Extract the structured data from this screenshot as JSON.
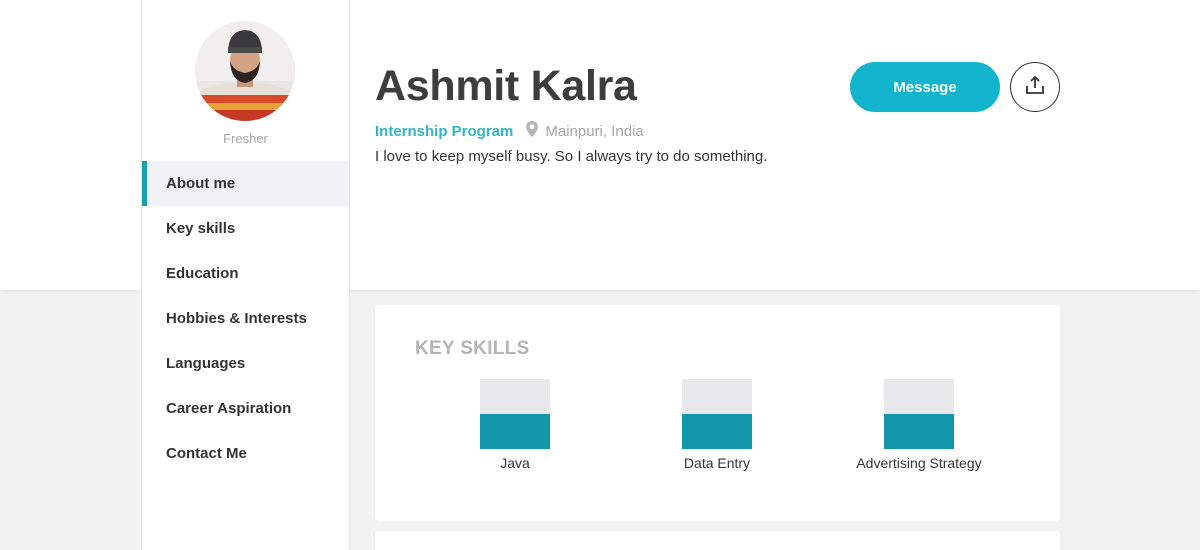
{
  "profile": {
    "role": "Fresher",
    "name": "Ashmit Kalra",
    "program": "Internship Program",
    "location": "Mainpuri, India",
    "bio": "I love to keep myself busy. So I always try to do something."
  },
  "nav": {
    "items": [
      {
        "label": "About me",
        "active": true
      },
      {
        "label": "Key skills"
      },
      {
        "label": "Education"
      },
      {
        "label": "Hobbies & Interests"
      },
      {
        "label": "Languages"
      },
      {
        "label": "Career Aspiration"
      },
      {
        "label": "Contact Me"
      }
    ]
  },
  "actions": {
    "message_label": "Message",
    "share_icon": "share-upload-icon"
  },
  "key_skills": {
    "title": "KEY SKILLS",
    "skills": [
      {
        "name": "Java",
        "level": 0.5
      },
      {
        "name": "Data Entry",
        "level": 0.5
      },
      {
        "name": "Advertising Strategy",
        "level": 0.5
      }
    ]
  },
  "colors": {
    "accent": "#1a9fb0",
    "button": "#12b3cd",
    "skill_fill": "#1297aa",
    "skill_track": "#e8e8eb"
  }
}
